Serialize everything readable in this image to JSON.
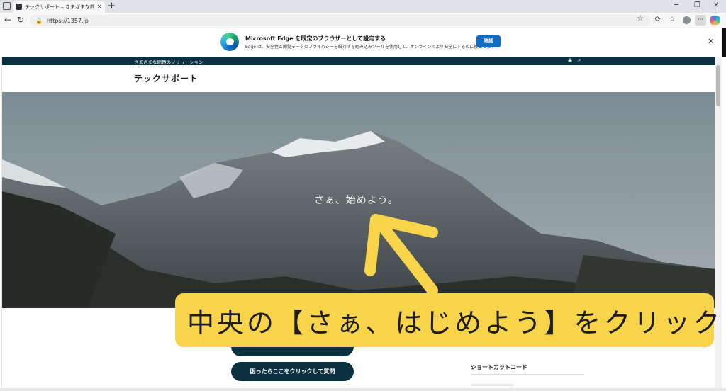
{
  "browser": {
    "tab_title": "テックサポート – さまざまな問題のソリュ",
    "url": "https://1357.jp"
  },
  "banner": {
    "title": "Microsoft Edge を既定のブラウザーとして設定する",
    "description": "Edge は、安全性と閲覧データのプライバシーを維持する組み込みツールを使用して、オンラインでより安全にするのに役立ちます",
    "confirm_label": "確認"
  },
  "site": {
    "tagline": "さまざまな問題のソリューション",
    "title": "テックサポート",
    "hero_text": "さぁ、始めよう。",
    "button_question": "困ったらここをクリックして質問",
    "sidebar_heading": "ショートカットコード"
  },
  "overlay": {
    "instruction": "中央の【さぁ、はじめよう】をクリック",
    "color": "#f7d44a"
  },
  "colors": {
    "site_dark": "#0b3140",
    "edge_blue": "#0a6ec9"
  }
}
